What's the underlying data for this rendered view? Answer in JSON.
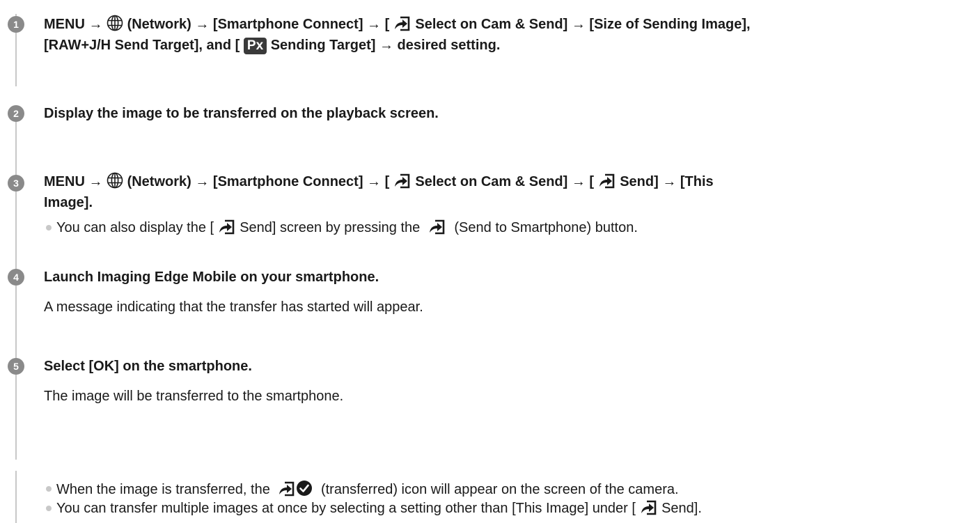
{
  "steps": [
    {
      "number": "1",
      "t": {
        "a": "MENU →",
        "b": "(Network) → [Smartphone Connect] → [",
        "c": "Select on Cam & Send] → [Size of Sending Image],",
        "d": "[RAW+J/H Send Target], and [",
        "e": "Px",
        "f": "Sending Target] → desired setting."
      }
    },
    {
      "number": "2",
      "t": {
        "a": "Display the image to be transferred on the playback screen."
      }
    },
    {
      "number": "3",
      "t": {
        "a": "MENU →",
        "b": "(Network) → [Smartphone Connect] → [",
        "c": "Select on Cam & Send] → [",
        "d": "Send] → [This",
        "e": "Image]."
      },
      "bullets": [
        {
          "a": "You can also display the [",
          "b": "Send] screen by pressing the",
          "c": "(Send to Smartphone) button."
        }
      ]
    },
    {
      "number": "4",
      "t": {
        "a": "Launch Imaging Edge Mobile on your smartphone."
      },
      "body": "A message indicating that the transfer has started will appear."
    },
    {
      "number": "5",
      "t": {
        "a": "Select [OK] on the smartphone."
      },
      "body": "The image will be transferred to the smartphone.",
      "bullets": [
        {
          "a": "When the image is transferred, the",
          "b": "(transferred) icon will appear on the screen of the camera."
        },
        {
          "a": "You can transfer multiple images at once by selecting a setting other than [This Image] under [",
          "b": "Send]."
        }
      ]
    }
  ]
}
